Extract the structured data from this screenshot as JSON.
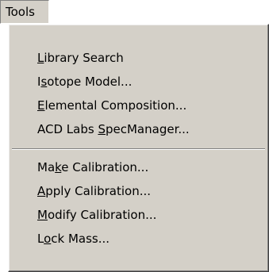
{
  "menubar": {
    "tools_label": "Tools"
  },
  "menu": {
    "group1": [
      {
        "pre": "",
        "mn": "L",
        "post": "ibrary Search"
      },
      {
        "pre": "I",
        "mn": "s",
        "post": "otope Model..."
      },
      {
        "pre": "",
        "mn": "E",
        "post": "lemental Composition..."
      },
      {
        "pre": "ACD Labs ",
        "mn": "S",
        "post": "pecManager..."
      }
    ],
    "group2": [
      {
        "pre": "Ma",
        "mn": "k",
        "post": "e Calibration..."
      },
      {
        "pre": "",
        "mn": "A",
        "post": "pply Calibration..."
      },
      {
        "pre": "",
        "mn": "M",
        "post": "odify Calibration..."
      },
      {
        "pre": "L",
        "mn": "o",
        "post": "ck Mass..."
      }
    ]
  }
}
